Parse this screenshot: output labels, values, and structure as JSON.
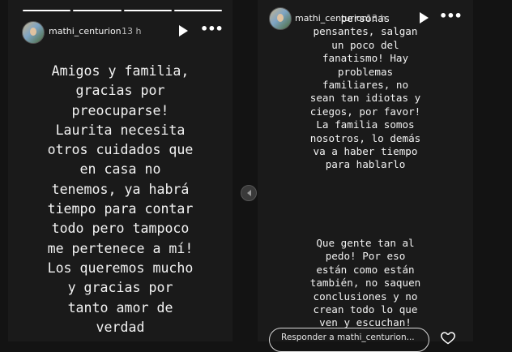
{
  "left_story": {
    "username": "mathi_centurion",
    "time": "13 h",
    "text": "Amigos y familia,\ngracias por\npreocuparse!\nLaurita necesita\notros cuidados que\nen casa no\ntenemos, ya habrá\ntiempo para contar\ntodo pero tampoco\nme pertenece a mí!\nLos queremos mucho\ny gracias por\ntanto amor de\nverdad"
  },
  "right_story": {
    "username": "mathi_centurion",
    "time": "13 h",
    "overlay_text": "personas",
    "text_top": "personas\npensantes, salgan\nun poco del\nfanatismo! Hay\nproblemas\nfamiliares, no\nsean tan idiotas y\nciegos, por favor!\nLa familia somos\nnosotros, lo demás\nva a haber tiempo\npara hablarlo",
    "text_bottom": "Que gente tan al\npedo! Por eso\nestán como están\ntambién, no saquen\nconclusiones y no\ncrean todo lo que\nven y escuchan!",
    "reply_placeholder": "Responder a mathi_centurion..."
  },
  "icons": {
    "play": "play-icon",
    "more": "more-options-icon",
    "previous": "chevron-left-icon",
    "like": "heart-icon"
  },
  "colors": {
    "background": "#131313",
    "story_background": "#1a1a1a",
    "text": "#f2f2f2"
  }
}
